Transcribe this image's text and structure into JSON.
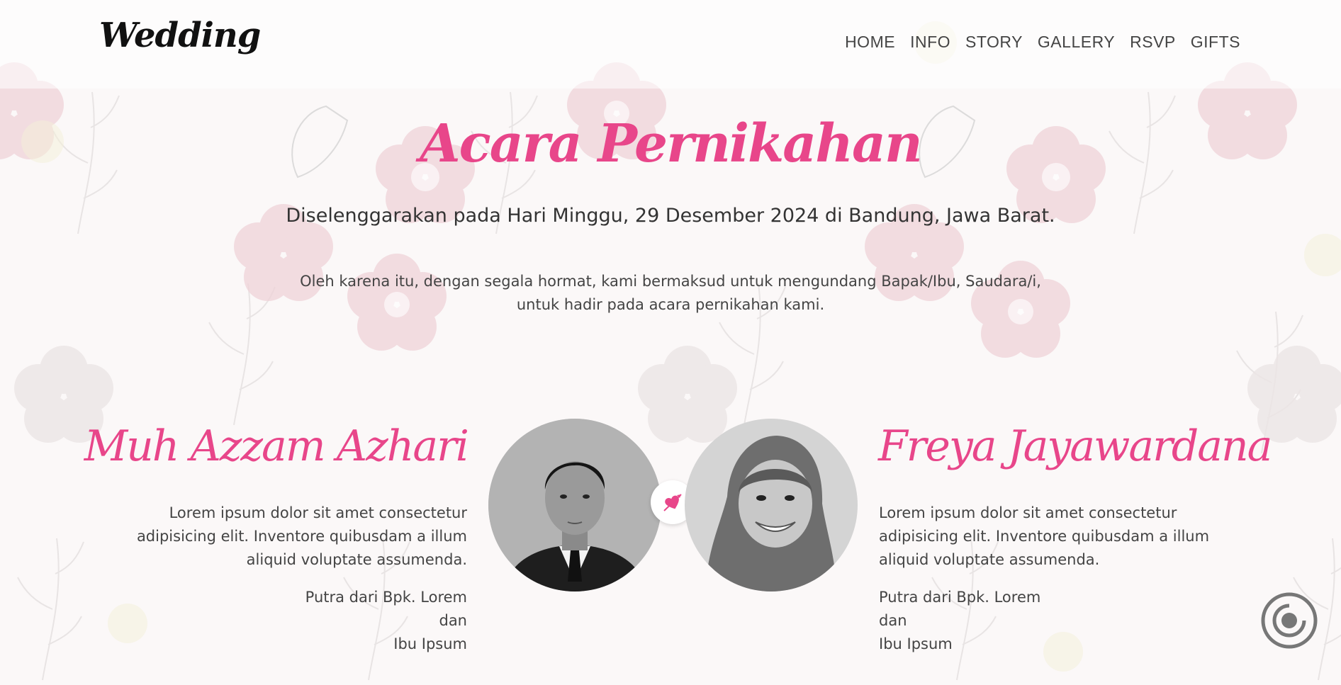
{
  "navbar": {
    "brand": "Wedding",
    "links": [
      "HOME",
      "INFO",
      "STORY",
      "GALLERY",
      "RSVP",
      "GIFTS"
    ]
  },
  "event": {
    "title": "Acara Pernikahan",
    "subtitle": "Diselenggarakan pada Hari Minggu, 29 Desember 2024 di Bandung, Jawa Barat.",
    "invitation": "Oleh karena itu, dengan segala hormat, kami bermaksud untuk mengundang Bapak/Ibu, Saudara/i, untuk hadir pada acara pernikahan kami."
  },
  "groom": {
    "name": "Muh Azzam Azhari",
    "description": "Lorem ipsum dolor sit amet consectetur adipisicing elit. Inventore quibusdam a illum aliquid voluptate assumenda.",
    "parents_line1": "Putra dari Bpk. Lorem",
    "parents_line2": "dan",
    "parents_line3": "Ibu Ipsum"
  },
  "bride": {
    "name": "Freya Jayawardana",
    "description": "Lorem ipsum dolor sit amet consectetur adipisicing elit. Inventore quibusdam a illum aliquid voluptate assumenda.",
    "parents_line1": "Putra dari Bpk. Lorem",
    "parents_line2": "dan",
    "parents_line3": "Ibu Ipsum"
  },
  "icons": {
    "couple_divider": "heart-arrow-icon",
    "music": "disc-icon"
  },
  "colors": {
    "accent": "#e8468a",
    "text": "#333333"
  }
}
